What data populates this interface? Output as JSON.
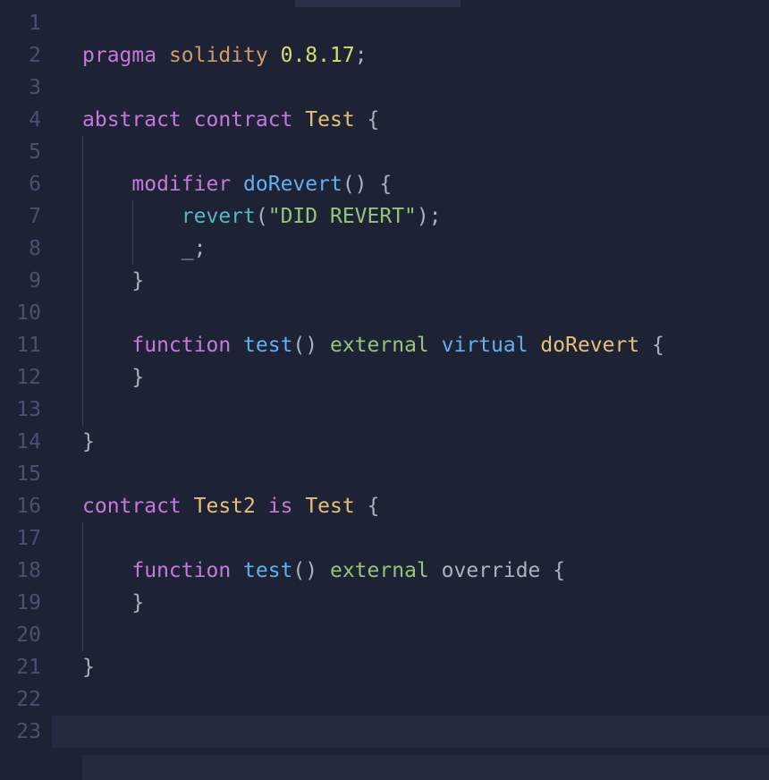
{
  "editor": {
    "language": "solidity",
    "current_line": 23,
    "lines": [
      {
        "n": 1,
        "indent": 0,
        "guides": [],
        "tokens": []
      },
      {
        "n": 2,
        "indent": 0,
        "guides": [],
        "tokens": [
          {
            "t": "pragma",
            "c": "tok-kw-pragma"
          },
          {
            "t": " ",
            "c": ""
          },
          {
            "t": "solidity",
            "c": "tok-ident"
          },
          {
            "t": " ",
            "c": ""
          },
          {
            "t": "0.8.17",
            "c": "tok-version"
          },
          {
            "t": ";",
            "c": "tok-punct"
          }
        ]
      },
      {
        "n": 3,
        "indent": 0,
        "guides": [],
        "tokens": []
      },
      {
        "n": 4,
        "indent": 0,
        "guides": [],
        "tokens": [
          {
            "t": "abstract",
            "c": "tok-kw-decl"
          },
          {
            "t": " ",
            "c": ""
          },
          {
            "t": "contract",
            "c": "tok-kw-contract"
          },
          {
            "t": " ",
            "c": ""
          },
          {
            "t": "Test",
            "c": "tok-type"
          },
          {
            "t": " ",
            "c": ""
          },
          {
            "t": "{",
            "c": "tok-punct"
          }
        ]
      },
      {
        "n": 5,
        "indent": 0,
        "guides": [
          1
        ],
        "tokens": []
      },
      {
        "n": 6,
        "indent": 1,
        "guides": [
          1
        ],
        "tokens": [
          {
            "t": "modifier",
            "c": "tok-kw-mod"
          },
          {
            "t": " ",
            "c": ""
          },
          {
            "t": "doRevert",
            "c": "tok-fn-name"
          },
          {
            "t": "()",
            "c": "tok-punct"
          },
          {
            "t": " ",
            "c": ""
          },
          {
            "t": "{",
            "c": "tok-punct"
          }
        ]
      },
      {
        "n": 7,
        "indent": 2,
        "guides": [
          1,
          2
        ],
        "tokens": [
          {
            "t": "revert",
            "c": "tok-builtin"
          },
          {
            "t": "(",
            "c": "tok-punct"
          },
          {
            "t": "\"DID REVERT\"",
            "c": "tok-string"
          },
          {
            "t": ")",
            "c": "tok-punct"
          },
          {
            "t": ";",
            "c": "tok-punct"
          }
        ]
      },
      {
        "n": 8,
        "indent": 2,
        "guides": [
          1,
          2
        ],
        "tokens": [
          {
            "t": "_",
            "c": "tok-placeholder"
          },
          {
            "t": ";",
            "c": "tok-punct"
          }
        ]
      },
      {
        "n": 9,
        "indent": 1,
        "guides": [
          1
        ],
        "tokens": [
          {
            "t": "}",
            "c": "tok-punct"
          }
        ]
      },
      {
        "n": 10,
        "indent": 0,
        "guides": [
          1
        ],
        "tokens": []
      },
      {
        "n": 11,
        "indent": 1,
        "guides": [
          1
        ],
        "tokens": [
          {
            "t": "function",
            "c": "tok-kw-mod"
          },
          {
            "t": " ",
            "c": ""
          },
          {
            "t": "test",
            "c": "tok-fn-name"
          },
          {
            "t": "()",
            "c": "tok-punct"
          },
          {
            "t": " ",
            "c": ""
          },
          {
            "t": "external",
            "c": "tok-kw-vis"
          },
          {
            "t": " ",
            "c": ""
          },
          {
            "t": "virtual",
            "c": "tok-kw-virtual"
          },
          {
            "t": " ",
            "c": ""
          },
          {
            "t": "doRevert",
            "c": "tok-type"
          },
          {
            "t": " ",
            "c": ""
          },
          {
            "t": "{",
            "c": "tok-punct"
          }
        ]
      },
      {
        "n": 12,
        "indent": 1,
        "guides": [
          1
        ],
        "tokens": [
          {
            "t": "}",
            "c": "tok-punct"
          }
        ]
      },
      {
        "n": 13,
        "indent": 0,
        "guides": [
          1
        ],
        "tokens": []
      },
      {
        "n": 14,
        "indent": 0,
        "guides": [],
        "tokens": [
          {
            "t": "}",
            "c": "tok-punct"
          }
        ]
      },
      {
        "n": 15,
        "indent": 0,
        "guides": [],
        "tokens": []
      },
      {
        "n": 16,
        "indent": 0,
        "guides": [],
        "tokens": [
          {
            "t": "contract",
            "c": "tok-kw-contract"
          },
          {
            "t": " ",
            "c": ""
          },
          {
            "t": "Test2",
            "c": "tok-type"
          },
          {
            "t": " ",
            "c": ""
          },
          {
            "t": "is",
            "c": "tok-kw-is"
          },
          {
            "t": " ",
            "c": ""
          },
          {
            "t": "Test",
            "c": "tok-type"
          },
          {
            "t": " ",
            "c": ""
          },
          {
            "t": "{",
            "c": "tok-punct"
          }
        ]
      },
      {
        "n": 17,
        "indent": 0,
        "guides": [
          1
        ],
        "tokens": []
      },
      {
        "n": 18,
        "indent": 1,
        "guides": [
          1
        ],
        "tokens": [
          {
            "t": "function",
            "c": "tok-kw-mod"
          },
          {
            "t": " ",
            "c": ""
          },
          {
            "t": "test",
            "c": "tok-fn-name"
          },
          {
            "t": "()",
            "c": "tok-punct"
          },
          {
            "t": " ",
            "c": ""
          },
          {
            "t": "external",
            "c": "tok-kw-vis"
          },
          {
            "t": " ",
            "c": ""
          },
          {
            "t": "override",
            "c": "tok-kw-override"
          },
          {
            "t": " ",
            "c": ""
          },
          {
            "t": "{",
            "c": "tok-punct"
          }
        ]
      },
      {
        "n": 19,
        "indent": 1,
        "guides": [
          1
        ],
        "tokens": [
          {
            "t": "}",
            "c": "tok-punct"
          }
        ]
      },
      {
        "n": 20,
        "indent": 0,
        "guides": [
          1
        ],
        "tokens": []
      },
      {
        "n": 21,
        "indent": 0,
        "guides": [],
        "tokens": [
          {
            "t": "}",
            "c": "tok-punct"
          }
        ]
      },
      {
        "n": 22,
        "indent": 0,
        "guides": [],
        "tokens": []
      },
      {
        "n": 23,
        "indent": 0,
        "guides": [],
        "tokens": []
      }
    ]
  }
}
